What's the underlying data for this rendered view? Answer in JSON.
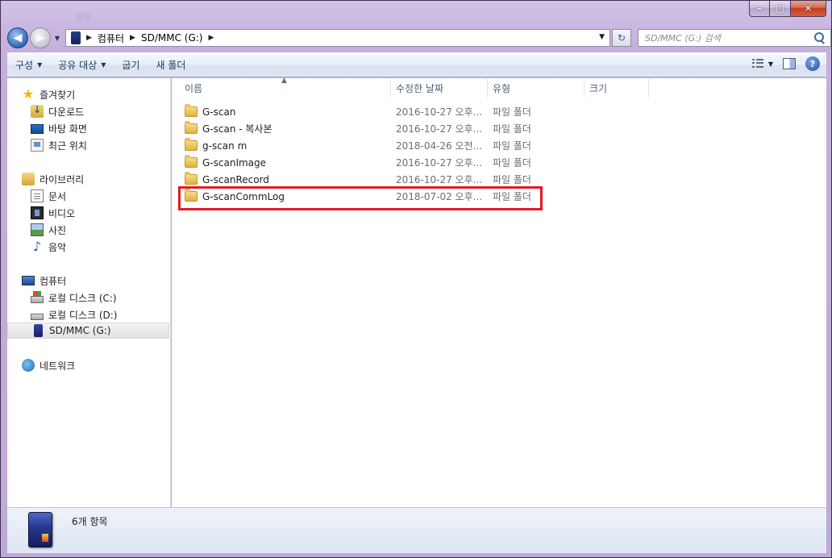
{
  "window": {
    "faint_title": "설정",
    "caption": {
      "minimize": "–",
      "maximize": "□",
      "close": "✕"
    }
  },
  "nav": {
    "back_glyph": "◀",
    "forward_glyph": "▶",
    "breadcrumb": [
      "컴퓨터",
      "SD/MMC (G:)"
    ],
    "search_placeholder": "SD/MMC (G:) 검색",
    "refresh_glyph": "↻"
  },
  "toolbar": {
    "organize": "구성",
    "share": "공유 대상",
    "burn": "굽기",
    "new_folder": "새 폴더"
  },
  "sidebar": {
    "favorites": {
      "label": "즐겨찾기",
      "items": [
        {
          "label": "다운로드",
          "icon": "download-icon"
        },
        {
          "label": "바탕 화면",
          "icon": "desktop-icon"
        },
        {
          "label": "최근 위치",
          "icon": "recent-places-icon"
        }
      ]
    },
    "libraries": {
      "label": "라이브러리",
      "items": [
        {
          "label": "문서",
          "icon": "documents-icon"
        },
        {
          "label": "비디오",
          "icon": "video-icon"
        },
        {
          "label": "사진",
          "icon": "pictures-icon"
        },
        {
          "label": "음악",
          "icon": "music-icon"
        }
      ]
    },
    "computer": {
      "label": "컴퓨터",
      "items": [
        {
          "label": "로컬 디스크 (C:)",
          "icon": "drive-c-icon"
        },
        {
          "label": "로컬 디스크 (D:)",
          "icon": "drive-d-icon"
        },
        {
          "label": "SD/MMC (G:)",
          "icon": "sd-card-icon",
          "selected": true
        }
      ]
    },
    "network": {
      "label": "네트워크"
    }
  },
  "columns": {
    "name": "이름",
    "modified": "수정한 날짜",
    "type": "유형",
    "size": "크기"
  },
  "files": [
    {
      "name": "G-scan",
      "modified": "2016-10-27 오후...",
      "type": "파일 폴더"
    },
    {
      "name": "G-scan - 복사본",
      "modified": "2016-10-27 오후...",
      "type": "파일 폴더"
    },
    {
      "name": "g-scan m",
      "modified": "2018-04-26 오전...",
      "type": "파일 폴더"
    },
    {
      "name": "G-scanImage",
      "modified": "2016-10-27 오후...",
      "type": "파일 폴더"
    },
    {
      "name": "G-scanRecord",
      "modified": "2016-10-27 오후...",
      "type": "파일 폴더"
    },
    {
      "name": "G-scanCommLog",
      "modified": "2018-07-02 오후...",
      "type": "파일 폴더",
      "highlighted": true
    }
  ],
  "details": {
    "item_count": "6개 항목"
  },
  "colors": {
    "highlight": "#e21b24",
    "window_frame": "#c4b0da"
  }
}
